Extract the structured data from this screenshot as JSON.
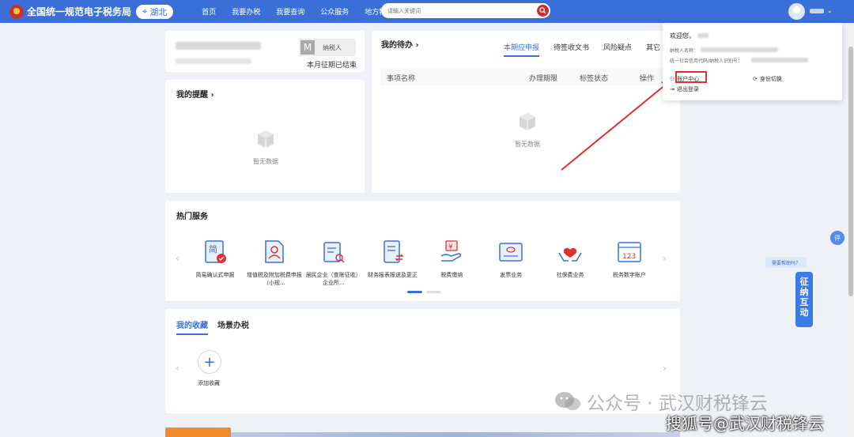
{
  "header": {
    "site_title": "全国统一规范电子税务局",
    "region": "湖北",
    "nav": [
      "首页",
      "我要办税",
      "我要查询",
      "公众服务",
      "地方特色"
    ],
    "search_placeholder": "请输入关键词"
  },
  "taxpayer_card": {
    "badge_letter": "M",
    "badge_text": "纳税人",
    "period_status": "本月征期已结束"
  },
  "reminders": {
    "title": "我的提醒",
    "empty_text": "暂无数据"
  },
  "todo": {
    "title": "我的待办",
    "tabs": [
      "本期应申报",
      "待签收文书",
      "风险疑点",
      "其它"
    ],
    "columns": [
      "事项名称",
      "办理期限",
      "标签状态",
      "操作"
    ],
    "empty_text": "暂无数据"
  },
  "hot_services": {
    "title": "热门服务",
    "items": [
      {
        "label": "简易确认式申报",
        "icon": "simple-form-icon"
      },
      {
        "label": "增值税及附加税费申报（小规...",
        "icon": "vat-person-icon"
      },
      {
        "label": "居民企业（查账征收）企业所...",
        "icon": "enterprise-search-icon"
      },
      {
        "label": "财务报表报送及更正",
        "icon": "report-swap-icon"
      },
      {
        "label": "税费缴纳",
        "icon": "tax-payment-icon"
      },
      {
        "label": "发票业务",
        "icon": "invoice-icon"
      },
      {
        "label": "社保费业务",
        "icon": "social-insurance-icon"
      },
      {
        "label": "税务数字账户",
        "icon": "digital-account-icon"
      }
    ]
  },
  "favorites": {
    "tabs": [
      "我的收藏",
      "场景办税"
    ],
    "add_label": "添加收藏"
  },
  "user_dropdown": {
    "welcome": "欢迎您，",
    "taxpayer_name_label": "纳税人名称：",
    "credit_code_label": "统一社会信用代码/纳税人识别号：",
    "account_center": "账户中心",
    "switch_identity": "身份切换",
    "logout": "退出登录"
  },
  "floating": {
    "ping": "评",
    "help": "需要帮助吗？",
    "interaction": "征纳互动"
  },
  "watermarks": {
    "wechat_text": "公众号 · 武汉财税锋云",
    "sohu_text": "搜狐号@武汉财税锋云"
  },
  "colors": {
    "brand_blue": "#3b6fd8",
    "highlight_red": "#e0302f"
  }
}
